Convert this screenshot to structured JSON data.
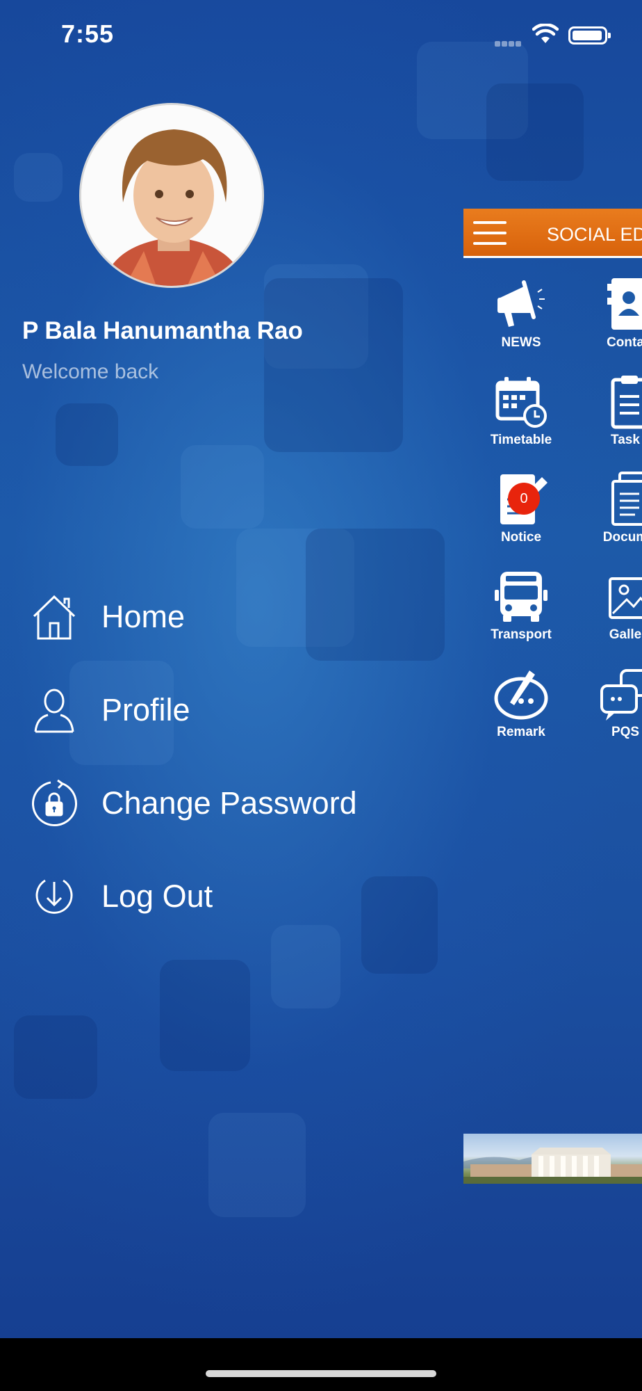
{
  "status_bar": {
    "time": "7:55"
  },
  "drawer": {
    "user_name": "P Bala Hanumantha Rao",
    "welcome_text": "Welcome back",
    "menu": [
      {
        "label": "Home",
        "icon": "home-icon"
      },
      {
        "label": "Profile",
        "icon": "person-icon"
      },
      {
        "label": "Change Password",
        "icon": "lock-refresh-icon"
      },
      {
        "label": "Log Out",
        "icon": "logout-icon"
      }
    ]
  },
  "main": {
    "app_bar_title": "SOCIAL EDU",
    "tiles": [
      {
        "label": "NEWS",
        "icon": "megaphone-icon"
      },
      {
        "label": "Conta",
        "icon": "contact-icon"
      },
      {
        "label": "Timetable",
        "icon": "calendar-clock-icon"
      },
      {
        "label": "Task",
        "icon": "clipboard-icon"
      },
      {
        "label": "Notice",
        "icon": "notice-icon",
        "badge": "0"
      },
      {
        "label": "Docum",
        "icon": "documents-icon"
      },
      {
        "label": "Transport",
        "icon": "school-bus-icon"
      },
      {
        "label": "Galle",
        "icon": "gallery-icon"
      },
      {
        "label": "Remark",
        "icon": "remark-icon"
      },
      {
        "label": "PQS",
        "icon": "chat-icon"
      }
    ]
  }
}
